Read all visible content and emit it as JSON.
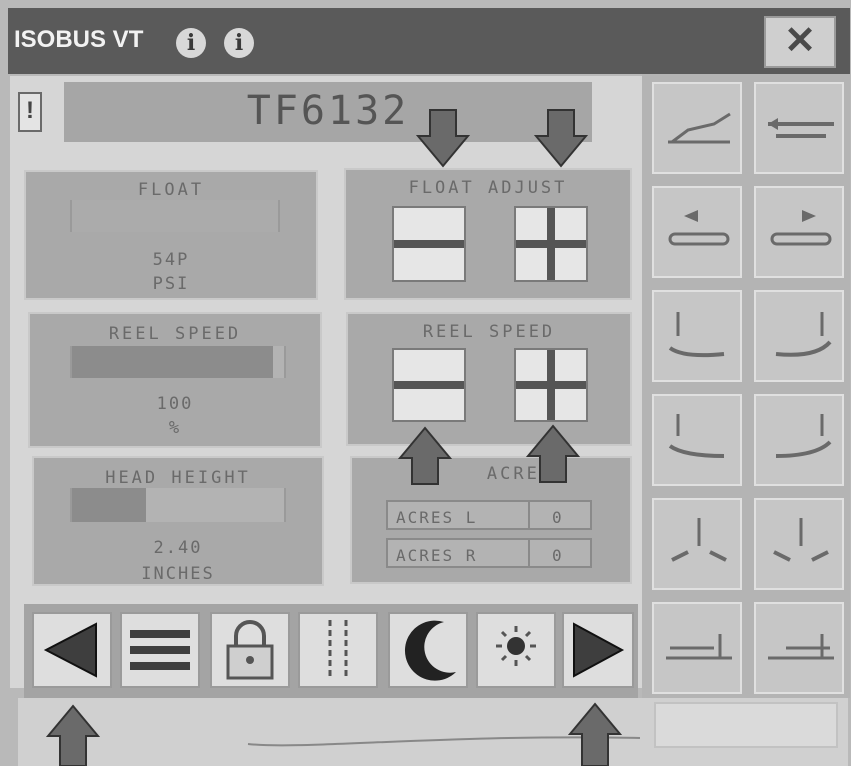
{
  "window": {
    "title": "ISOBUS VT",
    "close_label": "✕"
  },
  "header": {
    "warning_label": "!",
    "machine_id": "TF6132"
  },
  "float": {
    "label": "FLOAT",
    "value": "54P",
    "unit": "PSI"
  },
  "reel_speed": {
    "label": "REEL SPEED",
    "value": "100",
    "unit": "%",
    "level_fraction": 0.95
  },
  "head_height": {
    "label": "HEAD HEIGHT",
    "value": "2.40",
    "unit": "INCHES",
    "level_fraction": 0.35
  },
  "float_adjust": {
    "label": "FLOAT ADJUST"
  },
  "reel_adjust": {
    "label": "REEL SPEED"
  },
  "acres": {
    "label": "ACRES",
    "rows": [
      {
        "label": "ACRES L",
        "value": "0"
      },
      {
        "label": "ACRES R",
        "value": "0"
      }
    ]
  },
  "colors": {
    "panel": "#a9a9a9",
    "screen": "#d6d6d6",
    "titlebar": "#5a5a5a",
    "arrow": "#6a6a6a"
  },
  "toolbar_icons": [
    "prev-arrow-icon",
    "menu-icon",
    "lock-icon",
    "row-guide-icon",
    "moon-icon",
    "sun-icon",
    "next-arrow-icon"
  ],
  "side_icons": [
    "header-tilt-icon",
    "reel-fore-aft-icon",
    "reel-back-icon",
    "reel-forward-icon",
    "left-wing-up-icon",
    "right-wing-up-icon",
    "left-wing-down-icon",
    "right-wing-down-icon",
    "wings-up-icon",
    "wings-down-icon",
    "header-left-icon",
    "header-right-icon"
  ]
}
